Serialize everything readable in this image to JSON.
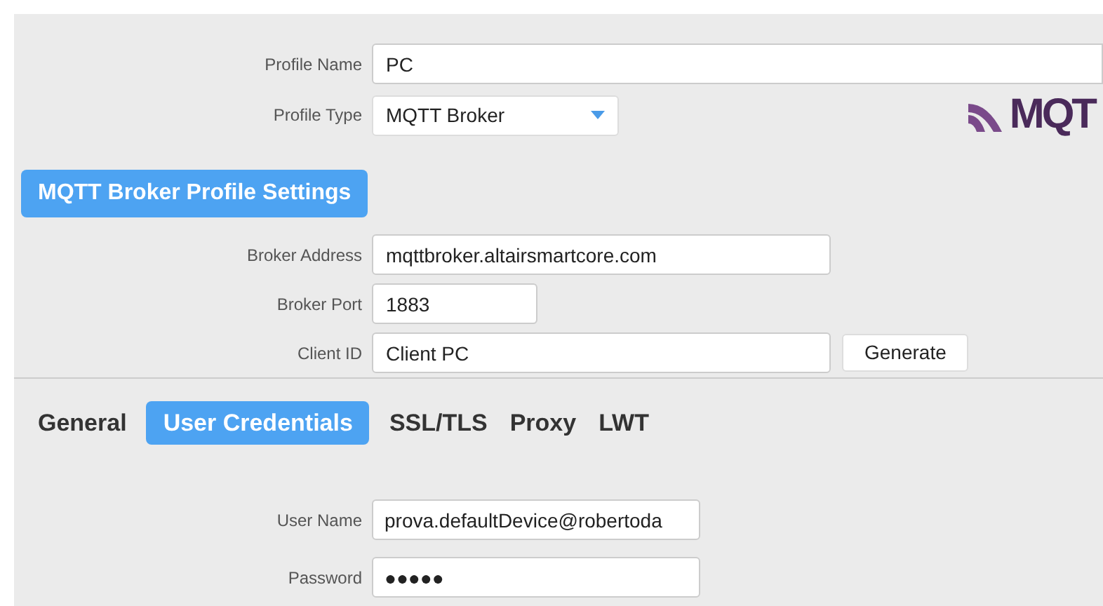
{
  "profile": {
    "fields": [
      {
        "label": "Profile Name",
        "value": "PC",
        "kind": "text"
      },
      {
        "label": "Profile Type",
        "value": "MQTT Broker",
        "kind": "select"
      }
    ],
    "logo": "MQT"
  },
  "section_title": "MQTT Broker Profile Settings",
  "broker": {
    "fields": [
      {
        "label": "Broker Address",
        "value": "mqttbroker.altairsmartcore.com",
        "kind": "wide"
      },
      {
        "label": "Broker Port",
        "value": "1883",
        "kind": "short"
      },
      {
        "label": "Client ID",
        "value": "Client PC",
        "kind": "wide",
        "button": "Generate"
      }
    ]
  },
  "tabs": [
    {
      "label": "General",
      "selected": false
    },
    {
      "label": "User Credentials",
      "selected": true
    },
    {
      "label": "SSL/TLS",
      "selected": false
    },
    {
      "label": "Proxy",
      "selected": false
    },
    {
      "label": "LWT",
      "selected": false
    }
  ],
  "credentials": {
    "fields": [
      {
        "label": "User Name",
        "value": "prova.defaultDevice@robertoda"
      },
      {
        "label": "Password",
        "value": "●●●●●"
      }
    ]
  }
}
